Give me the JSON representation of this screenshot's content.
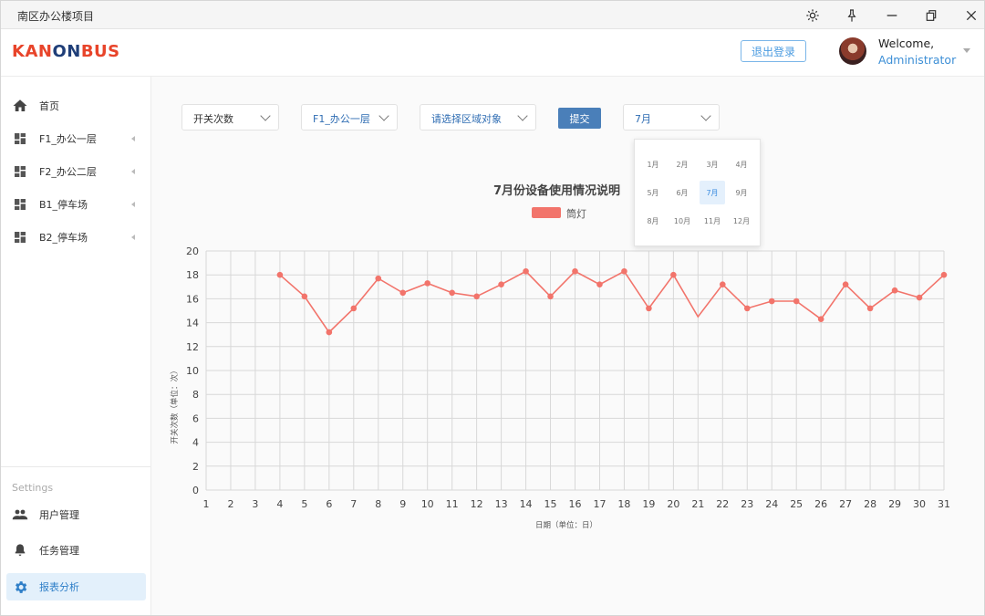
{
  "window": {
    "title": "南区办公楼项目"
  },
  "header": {
    "logo": "KANONBUS",
    "logout_label": "退出登录",
    "welcome": "Welcome,",
    "user": "Administrator"
  },
  "sidebar": {
    "items": [
      {
        "label": "首页",
        "icon": "home-icon"
      },
      {
        "label": "F1_办公一层",
        "icon": "dashboard-icon"
      },
      {
        "label": "F2_办公二层",
        "icon": "dashboard-icon"
      },
      {
        "label": "B1_停车场",
        "icon": "dashboard-icon"
      },
      {
        "label": "B2_停车场",
        "icon": "dashboard-icon"
      }
    ],
    "settings_label": "Settings",
    "settings_items": [
      {
        "label": "用户管理",
        "icon": "people-icon"
      },
      {
        "label": "任务管理",
        "icon": "bell-icon"
      },
      {
        "label": "报表分析",
        "icon": "gear-icon"
      }
    ]
  },
  "filters": {
    "metric": "开关次数",
    "floor": "F1_办公一层",
    "area_placeholder": "请选择区域对象",
    "submit": "提交",
    "month": "7月"
  },
  "month_picker": {
    "months": [
      "1月",
      "2月",
      "3月",
      "4月",
      "5月",
      "6月",
      "7月",
      "8月",
      "9月",
      "10月",
      "11月",
      "12月"
    ],
    "selected": "7月"
  },
  "colors": {
    "accent": "#3d8fd6",
    "series": "#f2746b",
    "logo_dark": "#1f3e78",
    "logo_red": "#e8442a"
  },
  "chart_data": {
    "type": "line",
    "title": "7月份设备使用情况说明",
    "xlabel": "日期（单位：日）",
    "ylabel": "开关次数（单位：次）",
    "x": [
      1,
      2,
      3,
      4,
      5,
      6,
      7,
      8,
      9,
      10,
      11,
      12,
      13,
      14,
      15,
      16,
      17,
      18,
      19,
      20,
      21,
      22,
      23,
      24,
      25,
      26,
      27,
      28,
      29,
      30,
      31
    ],
    "ylim": [
      0,
      20
    ],
    "yticks": [
      0,
      2,
      4,
      6,
      8,
      10,
      12,
      14,
      16,
      18,
      20
    ],
    "grid": true,
    "legend_position": "top",
    "series": [
      {
        "name": "筒灯",
        "points": [
          [
            4,
            18
          ],
          [
            5,
            16.2
          ],
          [
            6,
            13.2
          ],
          [
            7,
            15.2
          ],
          [
            8,
            17.7
          ],
          [
            9,
            16.5
          ],
          [
            10,
            17.3
          ],
          [
            11,
            16.5
          ],
          [
            12,
            16.2
          ],
          [
            13,
            17.2
          ],
          [
            14,
            18.3
          ],
          [
            15,
            16.2
          ],
          [
            16,
            18.3
          ],
          [
            17,
            17.2
          ],
          [
            18,
            18.3
          ],
          [
            19,
            15.2
          ],
          [
            20,
            18
          ],
          [
            21,
            14.5
          ],
          [
            22,
            17.2
          ],
          [
            23,
            15.2
          ],
          [
            24,
            15.8
          ],
          [
            25,
            15.8
          ],
          [
            26,
            14.3
          ],
          [
            27,
            17.2
          ],
          [
            28,
            15.2
          ],
          [
            29,
            16.7
          ],
          [
            30,
            16.1
          ],
          [
            31,
            18
          ]
        ],
        "markers": [
          4,
          5,
          6,
          7,
          8,
          9,
          10,
          11,
          12,
          13,
          14,
          15,
          16,
          17,
          18,
          19,
          20,
          22,
          23,
          24,
          25,
          26,
          27,
          28,
          29,
          30,
          31
        ]
      }
    ]
  }
}
